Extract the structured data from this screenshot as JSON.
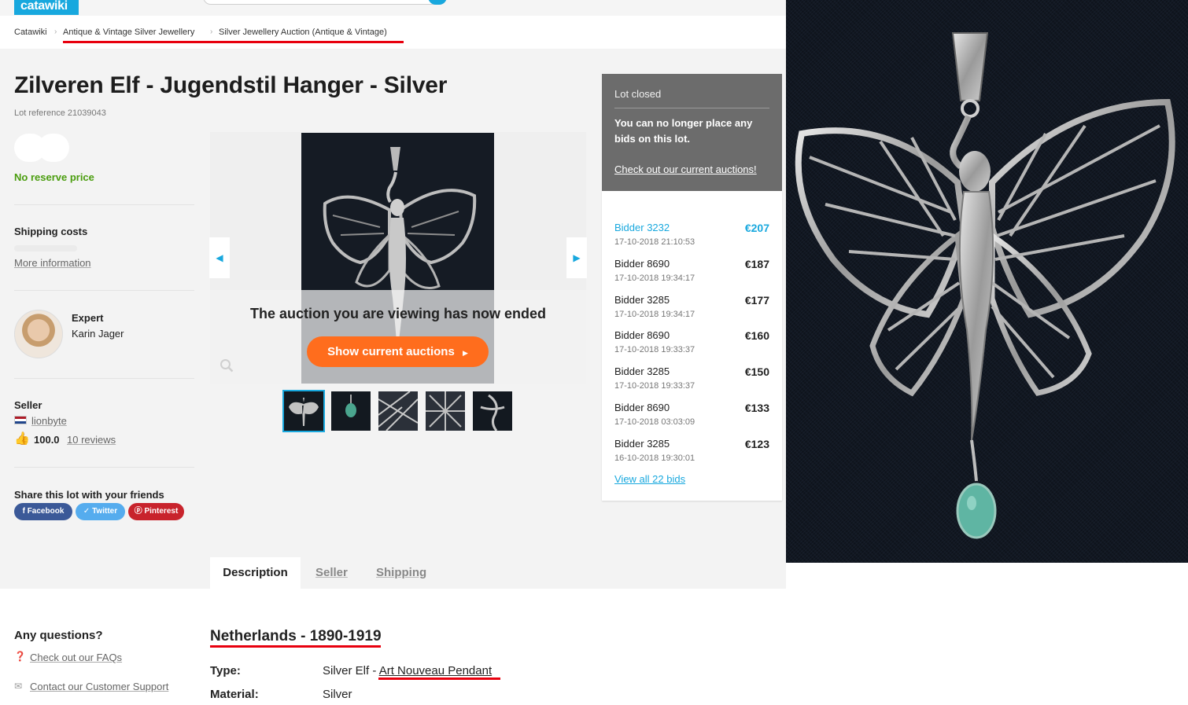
{
  "header": {
    "logo_text": "catawiki"
  },
  "breadcrumb": {
    "items": [
      "Catawiki",
      "Antique & Vintage Silver Jewellery",
      "Silver Jewellery Auction (Antique & Vintage)"
    ]
  },
  "lot": {
    "title": "Zilveren Elf - Jugendstil Hanger - Silver",
    "reference": "Lot reference 21039043",
    "reserve_label": "No reserve price"
  },
  "shipping": {
    "label": "Shipping costs",
    "more_info": "More information"
  },
  "expert": {
    "role": "Expert",
    "name": "Karin Jager"
  },
  "seller": {
    "label": "Seller",
    "name": "lionbyte",
    "score": "100.0",
    "reviews": "10 reviews"
  },
  "share": {
    "label": "Share this lot with your friends",
    "facebook": "Facebook",
    "twitter": "Twitter",
    "pinterest": "Pinterest"
  },
  "gallery": {
    "ended_message": "The auction you are viewing has now ended",
    "show_button": "Show current auctions",
    "thumbnail_count": 5
  },
  "status_panel": {
    "title": "Lot closed",
    "message": "You can no longer place any bids on this lot.",
    "link": "Check out our current auctions!"
  },
  "bids": [
    {
      "bidder": "Bidder 3232",
      "time": "17-10-2018 21:10:53",
      "amount": "€207"
    },
    {
      "bidder": "Bidder 8690",
      "time": "17-10-2018 19:34:17",
      "amount": "€187"
    },
    {
      "bidder": "Bidder 3285",
      "time": "17-10-2018 19:34:17",
      "amount": "€177"
    },
    {
      "bidder": "Bidder 8690",
      "time": "17-10-2018 19:33:37",
      "amount": "€160"
    },
    {
      "bidder": "Bidder 3285",
      "time": "17-10-2018 19:33:37",
      "amount": "€150"
    },
    {
      "bidder": "Bidder 8690",
      "time": "17-10-2018 03:03:09",
      "amount": "€133"
    },
    {
      "bidder": "Bidder 3285",
      "time": "16-10-2018 19:30:01",
      "amount": "€123"
    }
  ],
  "view_all_bids": "View all 22 bids",
  "tabs": [
    "Description",
    "Seller",
    "Shipping"
  ],
  "help": {
    "heading": "Any questions?",
    "faq": "Check out our FAQs",
    "support": "Contact our Customer Support"
  },
  "description": {
    "heading": "Netherlands - 1890-1919",
    "type_label": "Type:",
    "type_value_prefix": "Silver Elf - ",
    "type_value_link": "Art Nouveau Pendant",
    "material_label": "Material:",
    "material_value": "Silver"
  },
  "colors": {
    "brand": "#18a8de",
    "accent_orange": "#ff6d1d",
    "reserve_green": "#4a9d0e",
    "annotation_red": "#e8000e",
    "panel_gray": "#6c6c6c"
  }
}
